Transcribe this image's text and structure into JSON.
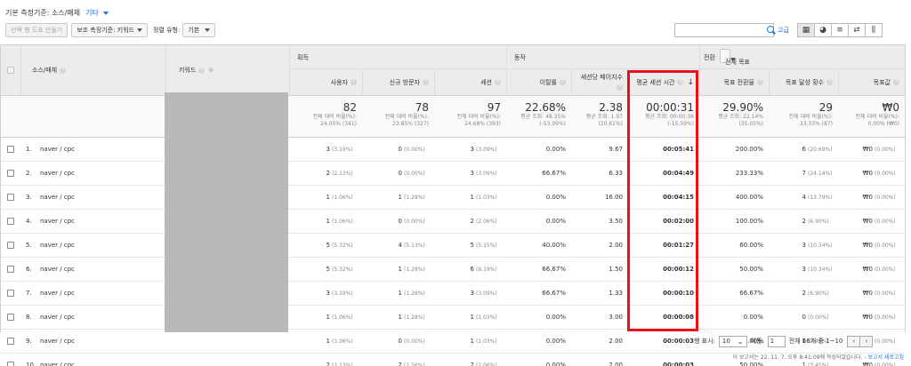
{
  "topline": {
    "label": "기본 측정기준: 소스/매체",
    "more": "기타"
  },
  "toolbar": {
    "segment_btn": "선택 행 도표 만들기",
    "secondary_dim": "보조 측정기준: 키워드",
    "sort_label": "정렬 유형:",
    "sort_value": "기본",
    "advanced": "고급",
    "view_icons": [
      "grid-view-icon",
      "pie-view-icon",
      "performance-view-icon",
      "compare-view-icon",
      "pivot-view-icon"
    ]
  },
  "header": {
    "source_medium": "소스/매체",
    "keyword": "키워드",
    "group_acquisition": "획득",
    "group_behavior": "동작",
    "conversions": "전환",
    "goal_select": "전체 목표",
    "metrics": [
      "사용자",
      "신규 방문자",
      "세션",
      "이탈률",
      "세션당 페이지수",
      "평균 세션 시간",
      "목표 전환율",
      "목표 달성 횟수",
      "목표값"
    ]
  },
  "totals": [
    {
      "big": "82",
      "sub1": "전체 대비 비율(%):",
      "sub2": "24.05% (341)"
    },
    {
      "big": "78",
      "sub1": "전체 대비 비율(%):",
      "sub2": "23.85% (327)"
    },
    {
      "big": "97",
      "sub1": "전체 대비 비율(%):",
      "sub2": "24.68% (393)"
    },
    {
      "big": "22.68%",
      "sub1": "평균 조회: 48.35%",
      "sub2": "(-53.09%)"
    },
    {
      "big": "2.38",
      "sub1": "평균 조회: 1.97",
      "sub2": "(20.61%)"
    },
    {
      "big": "00:00:31",
      "sub1": "평균 조회: 00:00:36",
      "sub2": "(-15.59%)"
    },
    {
      "big": "29.90%",
      "sub1": "평균 조회: 22.14%",
      "sub2": "(35.05%)"
    },
    {
      "big": "29",
      "sub1": "전체 대비 비율(%):",
      "sub2": "33.33% (87)"
    },
    {
      "big": "₩0",
      "sub1": "전체 대비 비율(%):",
      "sub2": "0.00% (₩0)"
    }
  ],
  "rows": [
    {
      "n": "1.",
      "src": "naver / cpc",
      "users": "3",
      "users_p": "(3.19%)",
      "new": "0",
      "new_p": "(0.00%)",
      "sess": "3",
      "sess_p": "(3.09%)",
      "bounce": "0.00%",
      "pps": "9.67",
      "dur": "00:05:41",
      "conv": "200.00%",
      "goal": "6",
      "goal_p": "(20.69%)",
      "val": "₩0",
      "val_p": "(0.00%)"
    },
    {
      "n": "2.",
      "src": "naver / cpc",
      "users": "2",
      "users_p": "(2.13%)",
      "new": "0",
      "new_p": "(0.00%)",
      "sess": "3",
      "sess_p": "(3.09%)",
      "bounce": "66.67%",
      "pps": "6.33",
      "dur": "00:04:49",
      "conv": "233.33%",
      "goal": "7",
      "goal_p": "(24.14%)",
      "val": "₩0",
      "val_p": "(0.00%)"
    },
    {
      "n": "3.",
      "src": "naver / cpc",
      "users": "1",
      "users_p": "(1.06%)",
      "new": "1",
      "new_p": "(1.28%)",
      "sess": "1",
      "sess_p": "(1.03%)",
      "bounce": "0.00%",
      "pps": "16.00",
      "dur": "00:04:15",
      "conv": "400.00%",
      "goal": "4",
      "goal_p": "(13.79%)",
      "val": "₩0",
      "val_p": "(0.00%)"
    },
    {
      "n": "4.",
      "src": "naver / cpc",
      "users": "1",
      "users_p": "(1.06%)",
      "new": "0",
      "new_p": "(0.00%)",
      "sess": "2",
      "sess_p": "(2.06%)",
      "bounce": "0.00%",
      "pps": "3.50",
      "dur": "00:02:00",
      "conv": "100.00%",
      "goal": "2",
      "goal_p": "(6.90%)",
      "val": "₩0",
      "val_p": "(0.00%)"
    },
    {
      "n": "5.",
      "src": "naver / cpc",
      "users": "5",
      "users_p": "(5.32%)",
      "new": "4",
      "new_p": "(5.13%)",
      "sess": "5",
      "sess_p": "(5.15%)",
      "bounce": "40.00%",
      "pps": "2.00",
      "dur": "00:01:27",
      "conv": "60.00%",
      "goal": "3",
      "goal_p": "(10.34%)",
      "val": "₩0",
      "val_p": "(0.00%)"
    },
    {
      "n": "6.",
      "src": "naver / cpc",
      "users": "5",
      "users_p": "(5.32%)",
      "new": "1",
      "new_p": "(1.28%)",
      "sess": "6",
      "sess_p": "(6.19%)",
      "bounce": "66.67%",
      "pps": "1.50",
      "dur": "00:00:12",
      "conv": "50.00%",
      "goal": "3",
      "goal_p": "(10.34%)",
      "val": "₩0",
      "val_p": "(0.00%)"
    },
    {
      "n": "7.",
      "src": "naver / cpc",
      "users": "3",
      "users_p": "(3.19%)",
      "new": "1",
      "new_p": "(1.28%)",
      "sess": "3",
      "sess_p": "(3.09%)",
      "bounce": "66.67%",
      "pps": "1.33",
      "dur": "00:00:10",
      "conv": "66.67%",
      "goal": "2",
      "goal_p": "(6.90%)",
      "val": "₩0",
      "val_p": "(0.00%)"
    },
    {
      "n": "8.",
      "src": "naver / cpc",
      "users": "1",
      "users_p": "(1.06%)",
      "new": "1",
      "new_p": "(1.28%)",
      "sess": "1",
      "sess_p": "(1.03%)",
      "bounce": "0.00%",
      "pps": "3.00",
      "dur": "00:00:08",
      "conv": "0.00%",
      "goal": "0",
      "goal_p": "(0.00%)",
      "val": "₩0",
      "val_p": "(0.00%)"
    },
    {
      "n": "9.",
      "src": "naver / cpc",
      "users": "1",
      "users_p": "(1.06%)",
      "new": "0",
      "new_p": "(0.00%)",
      "sess": "1",
      "sess_p": "(1.03%)",
      "bounce": "0.00%",
      "pps": "2.00",
      "dur": "00:00:03",
      "conv": "100.00%",
      "goal": "1",
      "goal_p": "(3.45%)",
      "val": "₩0",
      "val_p": "(0.00%)"
    },
    {
      "n": "10.",
      "src": "naver / cpc",
      "users": "2",
      "users_p": "(2.13%)",
      "new": "2",
      "new_p": "(2.56%)",
      "sess": "2",
      "sess_p": "(2.06%)",
      "bounce": "0.00%",
      "pps": "2.00",
      "dur": "00:00:03",
      "conv": "50.00%",
      "goal": "1",
      "goal_p": "(3.45%)",
      "val": "₩0",
      "val_p": "(0.00%)"
    }
  ],
  "pager": {
    "rows_label": "행 표시:",
    "rows_value": "10",
    "goto_label": "이동:",
    "goto_value": "1",
    "range": "전체 66개 중 1~10"
  },
  "footer": {
    "text": "이 보고서는 22. 11. 7. 오후 8:41:09에 작성되었습니다. -",
    "link": "보고서 새로고침"
  },
  "colors": {
    "highlight": "#e8101a",
    "link": "#1a73e8"
  }
}
